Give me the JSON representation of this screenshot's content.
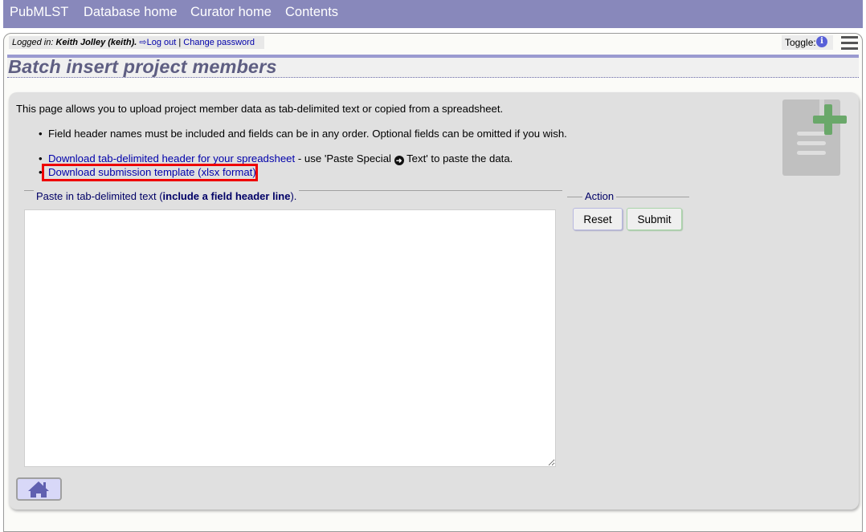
{
  "menu": {
    "items": [
      "PubMLST",
      "Database home",
      "Curator home",
      "Contents"
    ]
  },
  "session": {
    "logged_in_label": "Logged in:",
    "user": "Keith Jolley (keith).",
    "logout_label": "Log out",
    "separator": "|",
    "change_password_label": "Change password",
    "toggle_label": "Toggle:",
    "info_icon_glyph": "i"
  },
  "page": {
    "title": "Batch insert project members"
  },
  "intro": {
    "text": "This page allows you to upload project member data as tab-delimited text or copied from a spreadsheet.",
    "bullet_glyph": "•",
    "bullet1": "Field header names must be included and fields can be in any order. Optional fields can be omitted if you wish.",
    "bullet2_link": "Download tab-delimited header for your spreadsheet",
    "bullet2_text_before": " - use 'Paste Special ",
    "bullet2_arrow": "➜",
    "bullet2_text_after": " Text' to paste the data.",
    "bullet3_link": "Download submission template (xlsx format)"
  },
  "form": {
    "paste_legend_prefix": "Paste in tab-delimited text (",
    "paste_legend_bold": "include a field header line",
    "paste_legend_suffix": ").",
    "textarea_value": "",
    "action_legend": "Action",
    "reset_label": "Reset",
    "submit_label": "Submit"
  },
  "colors": {
    "menubar": "#8888bb",
    "link": "#0000aa",
    "title": "#5e5e82",
    "highlight": "#ee0000",
    "plus_icon": "#6aa86a"
  }
}
